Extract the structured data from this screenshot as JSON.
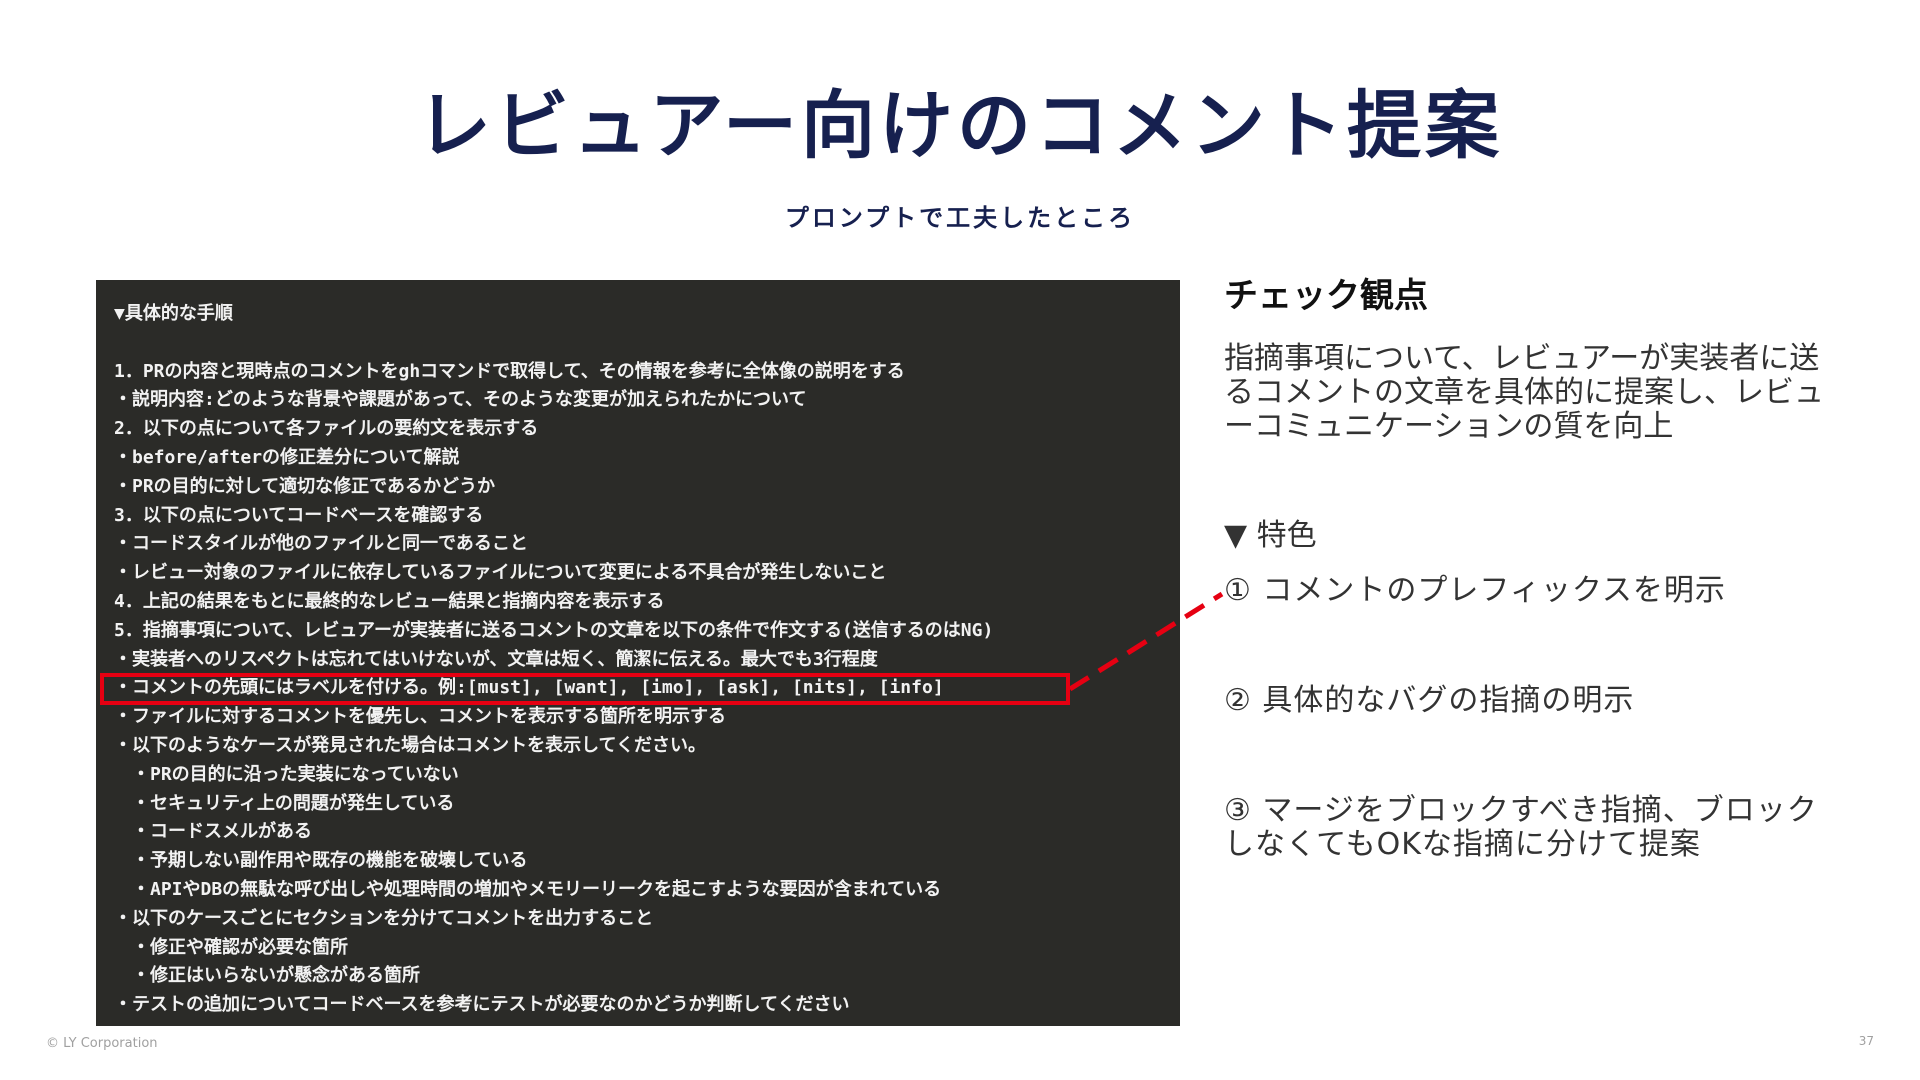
{
  "slide": {
    "title": "レビュアー向けのコメント提案",
    "subtitle": "プロンプトで工夫したところ"
  },
  "code_panel": {
    "lines": [
      "▼具体的な手順",
      "",
      "1．PRの内容と現時点のコメントをghコマンドで取得して、その情報を参考に全体像の説明をする",
      "・説明内容:どのような背景や課題があって、そのような変更が加えられたかについて",
      "2．以下の点について各ファイルの要約文を表示する",
      "・before/afterの修正差分について解説",
      "・PRの目的に対して適切な修正であるかどうか",
      "3．以下の点についてコードベースを確認する",
      "・コードスタイルが他のファイルと同一であること",
      "・レビュー対象のファイルに依存しているファイルについて変更による不具合が発生しないこと",
      "4．上記の結果をもとに最終的なレビュー結果と指摘内容を表示する",
      "5．指摘事項について、レビュアーが実装者に送るコメントの文章を以下の条件で作文する(送信するのはNG)",
      "・実装者へのリスペクトは忘れてはいけないが、文章は短く、簡潔に伝える。最大でも3行程度",
      "・コメントの先頭にはラベルを付ける。例:[must], [want], [imo], [ask], [nits], [info]",
      "・ファイルに対するコメントを優先し、コメントを表示する箇所を明示する",
      "・以下のようなケースが発見された場合はコメントを表示してください。",
      "　・PRの目的に沿った実装になっていない",
      "　・セキュリティ上の問題が発生している",
      "　・コードスメルがある",
      "　・予期しない副作用や既存の機能を破壊している",
      "　・APIやDBの無駄な呼び出しや処理時間の増加やメモリーリークを起こすような要因が含まれている",
      "・以下のケースごとにセクションを分けてコメントを出力すること",
      "　・修正や確認が必要な箇所",
      "　・修正はいらないが懸念がある箇所",
      "・テストの追加についてコードベースを参考にテストが必要なのかどうか判断してください"
    ]
  },
  "right_panel": {
    "check_heading": "チェック観点",
    "check_description": "指摘事項について、レビュアーが実装者に送るコメントの文章を具体的に提案し、レビューコミュニケーションの質を向上",
    "feature_heading": "▼ 特色",
    "features": [
      "① コメントのプレフィックスを明示",
      "② 具体的なバグの指摘の明示",
      "③ マージをブロックすべき指摘、ブロックしなくてもOKな指摘に分けて提案"
    ]
  },
  "footer": {
    "copyright": "© LY Corporation",
    "page_number": "37"
  },
  "colors": {
    "title": "#16204f",
    "code_background": "#2b2b28",
    "code_text": "#f2f2f2",
    "highlight": "#e60012",
    "body_text": "#333333"
  }
}
